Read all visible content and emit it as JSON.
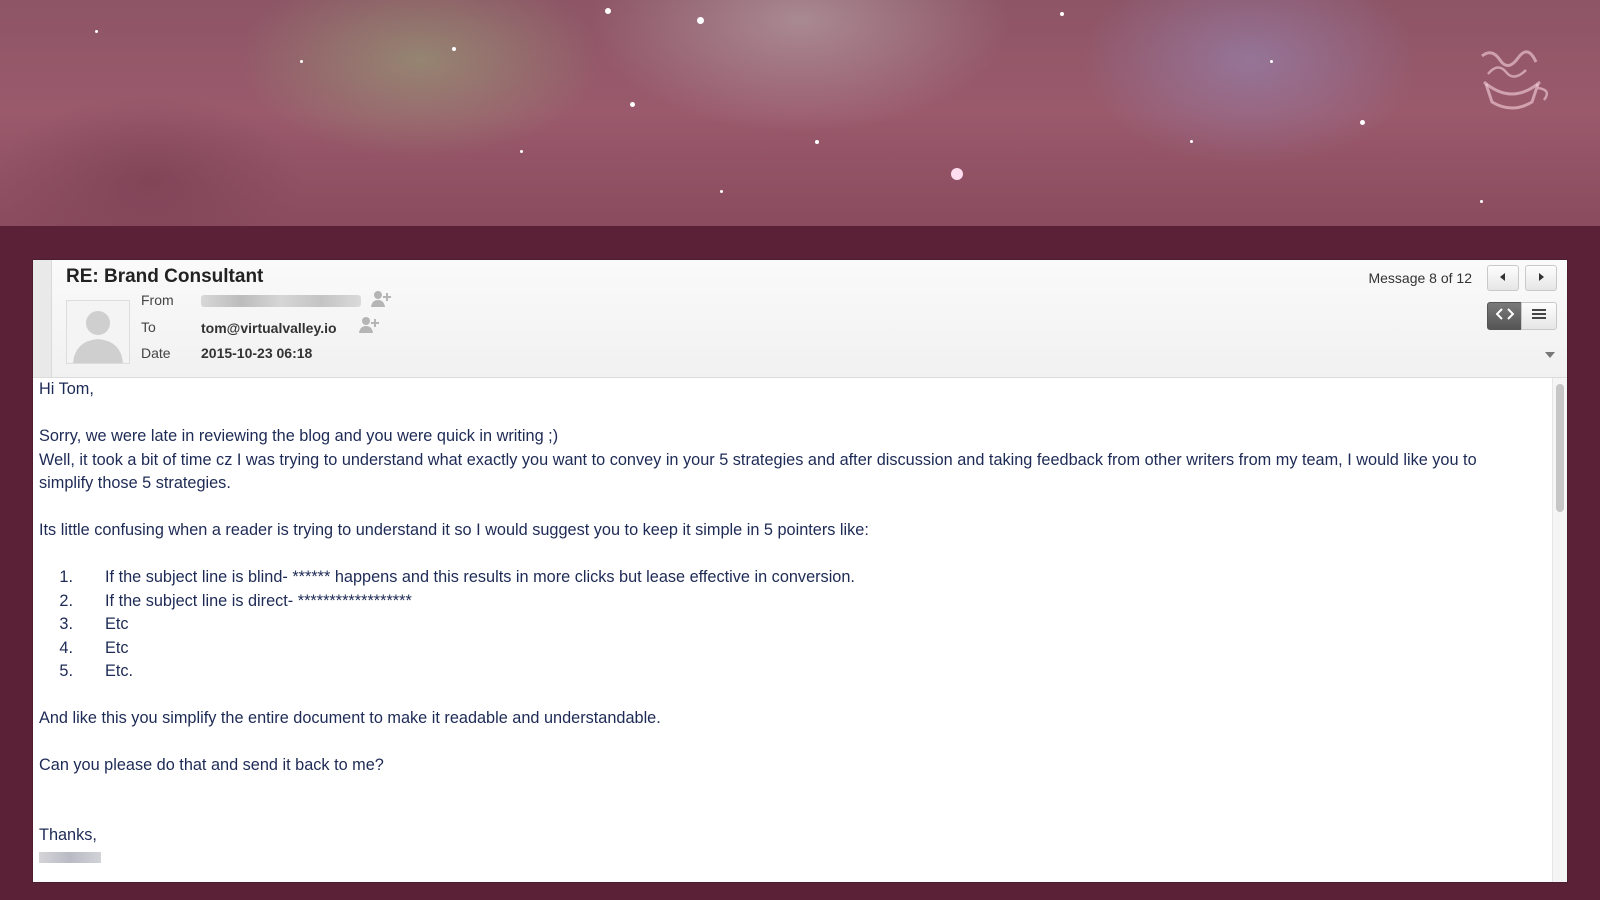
{
  "email": {
    "subject": "RE: Brand Consultant",
    "message_counter": "Message 8 of 12",
    "meta": {
      "from_label": "From",
      "to_label": "To",
      "date_label": "Date",
      "to_value": "tom@virtualvalley.io",
      "date_value": "2015-10-23 06:18"
    },
    "body": {
      "greeting": "Hi Tom,",
      "p1": "Sorry, we were late in reviewing the blog and you were quick in writing ;)",
      "p2": "Well, it took a bit of time cz I was trying to understand what exactly you want to convey in your 5 strategies and after discussion and taking feedback from other writers from my team, I would like you to simplify those 5 strategies.",
      "p3": "Its little confusing when a reader is trying to understand it so I would suggest you to keep it simple in 5 pointers like:",
      "list": [
        {
          "num": "1.",
          "text": "If the subject line is blind- ****** happens and this results in more clicks but lease effective in conversion."
        },
        {
          "num": "2.",
          "text": "If the subject line is direct- ******************"
        },
        {
          "num": "3.",
          "text": "Etc"
        },
        {
          "num": "4.",
          "text": "Etc"
        },
        {
          "num": "5.",
          "text": "Etc."
        }
      ],
      "p4": "And like this you simplify the entire document to make it readable and understandable.",
      "p5": "Can you please do that and send it back to me?",
      "closing": "Thanks,"
    }
  },
  "icons": {
    "prev": "chevron-left-icon",
    "next": "chevron-right-icon",
    "source_view": "code-icon",
    "plain_view": "lines-icon",
    "add_contact": "add-contact-icon",
    "logo": "coffee-cup-logo"
  },
  "colors": {
    "background": "#5b2237",
    "body_text": "#1d2a55"
  }
}
